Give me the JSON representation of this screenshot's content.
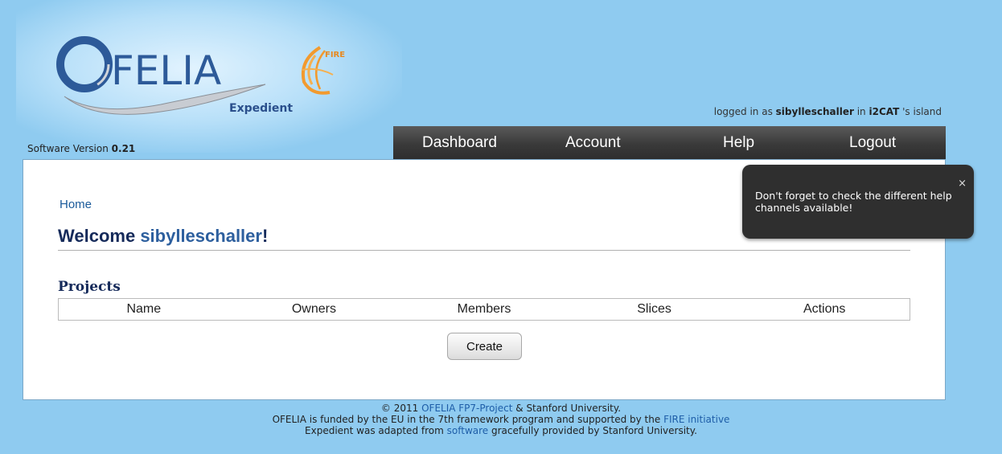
{
  "header": {
    "logo_text": "FELIA",
    "logo_initial": "O",
    "fire_text": "FIRE",
    "subtitle": "Expedient",
    "login_prefix": "logged in as",
    "login_user": "sibylleschaller",
    "login_in": "in",
    "login_island": "i2CAT",
    "login_suffix": "'s island",
    "version_label": "Software Version",
    "version_value": "0.21"
  },
  "nav": {
    "items": [
      "Dashboard",
      "Account",
      "Help",
      "Logout"
    ]
  },
  "main": {
    "breadcrumb": "Home",
    "welcome_prefix": "Welcome",
    "welcome_user": "sibylleschaller",
    "welcome_suffix": "!",
    "projects_heading": "Projects",
    "table_headers": [
      "Name",
      "Owners",
      "Members",
      "Slices",
      "Actions"
    ],
    "create_label": "Create"
  },
  "tooltip": {
    "text": "Don't forget to check the different help channels available!",
    "close": "×"
  },
  "footer": {
    "line1_prefix": "© 2011",
    "line1_link": "OFELIA FP7-Project",
    "line1_suffix": "& Stanford University.",
    "line2_prefix": "OFELIA is funded by the EU in the 7th framework program and supported by the",
    "line2_link": "FIRE initiative",
    "line3_prefix": "Expedient was adapted from",
    "line3_link": "software",
    "line3_suffix": "gracefully provided by Stanford University."
  },
  "colors": {
    "background": "#8fcbf0",
    "nav_bar": "#3a3a3a",
    "heading": "#152a5a",
    "link": "#1e5ea8"
  }
}
